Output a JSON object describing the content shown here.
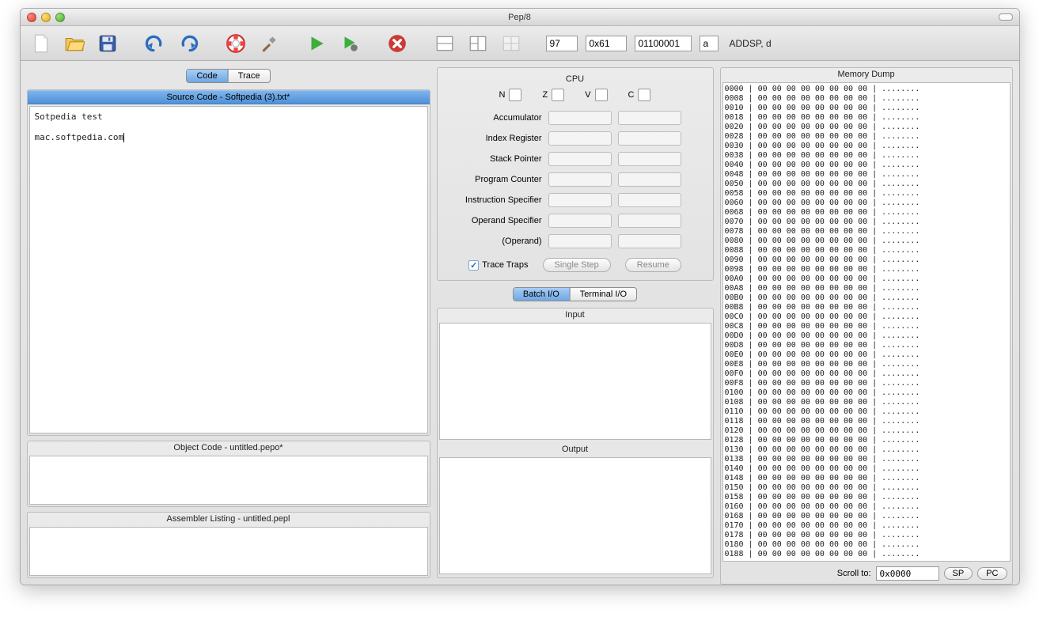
{
  "window": {
    "title": "Pep/8"
  },
  "toolbar": {
    "inputs": {
      "dec": "97",
      "hex": "0x61",
      "bin": "01100001",
      "char": "a"
    },
    "mnemonic": "ADDSP, d"
  },
  "code": {
    "tabs": {
      "code": "Code",
      "trace": "Trace"
    },
    "source": {
      "title": "Source Code - Softpedia (3).txt*",
      "line1": "Sotpedia test",
      "line2": "mac.softpedia.com"
    },
    "object_title": "Object Code - untitled.pepo*",
    "asm_title": "Assembler Listing - untitled.pepl"
  },
  "cpu": {
    "title": "CPU",
    "flags": {
      "n": "N",
      "z": "Z",
      "v": "V",
      "c": "C"
    },
    "regs": {
      "accumulator": "Accumulator",
      "index": "Index Register",
      "sp": "Stack Pointer",
      "pc": "Program Counter",
      "is": "Instruction Specifier",
      "os": "Operand Specifier",
      "operand": "(Operand)"
    },
    "trace_traps": "Trace Traps",
    "single_step": "Single Step",
    "resume": "Resume"
  },
  "io": {
    "tabs": {
      "batch": "Batch I/O",
      "terminal": "Terminal I/O"
    },
    "input": "Input",
    "output": "Output"
  },
  "memory": {
    "title": "Memory Dump",
    "scroll_label": "Scroll to:",
    "scroll_value": "0x0000",
    "sp": "SP",
    "pc": "PC"
  }
}
